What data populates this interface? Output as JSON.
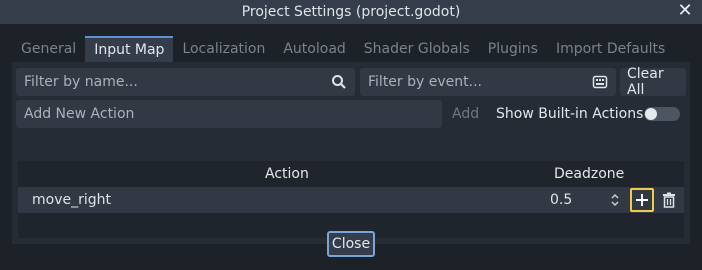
{
  "window": {
    "title": "Project Settings (project.godot)"
  },
  "tabs": [
    {
      "label": "General"
    },
    {
      "label": "Input Map"
    },
    {
      "label": "Localization"
    },
    {
      "label": "Autoload"
    },
    {
      "label": "Shader Globals"
    },
    {
      "label": "Plugins"
    },
    {
      "label": "Import Defaults"
    }
  ],
  "filters": {
    "name_placeholder": "Filter by name...",
    "event_placeholder": "Filter by event...",
    "clear_all_label": "Clear All"
  },
  "add_action": {
    "placeholder": "Add New Action",
    "add_label": "Add",
    "show_builtin_label": "Show Built-in Actions",
    "show_builtin_enabled": false
  },
  "table": {
    "columns": [
      "Action",
      "Deadzone"
    ],
    "rows": [
      {
        "action": "move_right",
        "deadzone": "0.5"
      }
    ]
  },
  "footer": {
    "close_label": "Close"
  },
  "colors": {
    "accent": "#5b91cf",
    "focus": "#f0cd48"
  }
}
